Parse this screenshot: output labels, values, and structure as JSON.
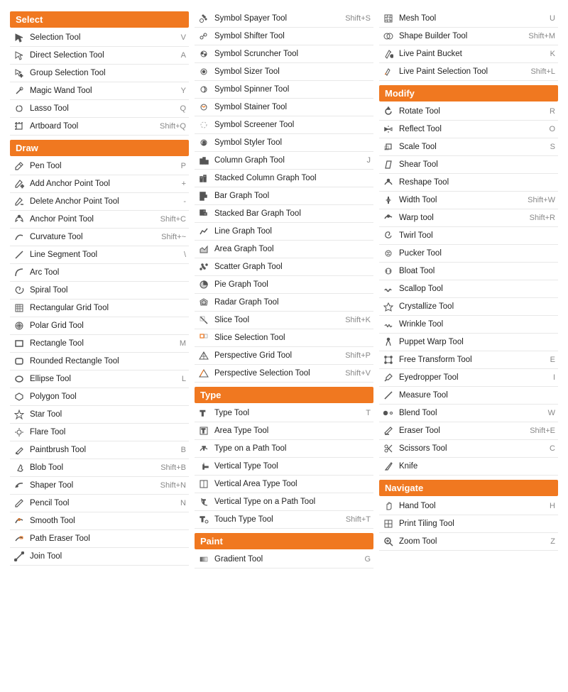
{
  "columns": [
    {
      "sections": [
        {
          "header": "Select",
          "tools": [
            {
              "name": "Selection Tool",
              "shortcut": "V",
              "icon": "arrow"
            },
            {
              "name": "Direct Selection Tool",
              "shortcut": "A",
              "icon": "arrow-hollow"
            },
            {
              "name": "Group Selection Tool",
              "shortcut": "",
              "icon": "arrow-plus"
            },
            {
              "name": "Magic Wand Tool",
              "shortcut": "Y",
              "icon": "wand"
            },
            {
              "name": "Lasso Tool",
              "shortcut": "Q",
              "icon": "lasso"
            },
            {
              "name": "Artboard Tool",
              "shortcut": "Shift+Q",
              "icon": "artboard"
            }
          ]
        },
        {
          "header": "Draw",
          "tools": [
            {
              "name": "Pen Tool",
              "shortcut": "P",
              "icon": "pen"
            },
            {
              "name": "Add Anchor Point Tool",
              "shortcut": "+",
              "icon": "pen-plus"
            },
            {
              "name": "Delete Anchor Point Tool",
              "shortcut": "-",
              "icon": "pen-minus"
            },
            {
              "name": "Anchor Point Tool",
              "shortcut": "Shift+C",
              "icon": "anchor"
            },
            {
              "name": "Curvature Tool",
              "shortcut": "Shift+~",
              "icon": "curve"
            },
            {
              "name": "Line Segment Tool",
              "shortcut": "\\",
              "icon": "line"
            },
            {
              "name": "Arc Tool",
              "shortcut": "",
              "icon": "arc"
            },
            {
              "name": "Spiral Tool",
              "shortcut": "",
              "icon": "spiral"
            },
            {
              "name": "Rectangular Grid Tool",
              "shortcut": "",
              "icon": "grid-rect"
            },
            {
              "name": "Polar Grid Tool",
              "shortcut": "",
              "icon": "grid-polar"
            },
            {
              "name": "Rectangle Tool",
              "shortcut": "M",
              "icon": "rect"
            },
            {
              "name": "Rounded Rectangle Tool",
              "shortcut": "",
              "icon": "rect-round"
            },
            {
              "name": "Ellipse Tool",
              "shortcut": "L",
              "icon": "ellipse"
            },
            {
              "name": "Polygon Tool",
              "shortcut": "",
              "icon": "polygon"
            },
            {
              "name": "Star Tool",
              "shortcut": "",
              "icon": "star"
            },
            {
              "name": "Flare Tool",
              "shortcut": "",
              "icon": "flare"
            },
            {
              "name": "Paintbrush Tool",
              "shortcut": "B",
              "icon": "brush"
            },
            {
              "name": "Blob Tool",
              "shortcut": "Shift+B",
              "icon": "blob"
            },
            {
              "name": "Shaper Tool",
              "shortcut": "Shift+N",
              "icon": "shaper"
            },
            {
              "name": "Pencil Tool",
              "shortcut": "N",
              "icon": "pencil"
            },
            {
              "name": "Smooth Tool",
              "shortcut": "",
              "icon": "smooth"
            },
            {
              "name": "Path Eraser Tool",
              "shortcut": "",
              "icon": "path-eraser"
            },
            {
              "name": "Join Tool",
              "shortcut": "",
              "icon": "join"
            }
          ]
        }
      ]
    },
    {
      "sections": [
        {
          "header": null,
          "tools": [
            {
              "name": "Symbol Spayer Tool",
              "shortcut": "Shift+S",
              "icon": "symbol-spray"
            },
            {
              "name": "Symbol Shifter Tool",
              "shortcut": "",
              "icon": "symbol-shift"
            },
            {
              "name": "Symbol Scruncher Tool",
              "shortcut": "",
              "icon": "symbol-scrunch"
            },
            {
              "name": "Symbol Sizer Tool",
              "shortcut": "",
              "icon": "symbol-size"
            },
            {
              "name": "Symbol Spinner Tool",
              "shortcut": "",
              "icon": "symbol-spin"
            },
            {
              "name": "Symbol Stainer Tool",
              "shortcut": "",
              "icon": "symbol-stain"
            },
            {
              "name": "Symbol Screener Tool",
              "shortcut": "",
              "icon": "symbol-screen"
            },
            {
              "name": "Symbol Styler Tool",
              "shortcut": "",
              "icon": "symbol-style"
            },
            {
              "name": "Column Graph Tool",
              "shortcut": "J",
              "icon": "graph-col"
            },
            {
              "name": "Stacked Column Graph Tool",
              "shortcut": "",
              "icon": "graph-stack-col"
            },
            {
              "name": "Bar Graph Tool",
              "shortcut": "",
              "icon": "graph-bar"
            },
            {
              "name": "Stacked Bar Graph Tool",
              "shortcut": "",
              "icon": "graph-stack-bar"
            },
            {
              "name": "Line Graph Tool",
              "shortcut": "",
              "icon": "graph-line"
            },
            {
              "name": "Area Graph Tool",
              "shortcut": "",
              "icon": "graph-area"
            },
            {
              "name": "Scatter Graph Tool",
              "shortcut": "",
              "icon": "graph-scatter"
            },
            {
              "name": "Pie Graph Tool",
              "shortcut": "",
              "icon": "graph-pie"
            },
            {
              "name": "Radar Graph Tool",
              "shortcut": "",
              "icon": "graph-radar"
            },
            {
              "name": "Slice Tool",
              "shortcut": "Shift+K",
              "icon": "slice"
            },
            {
              "name": "Slice Selection Tool",
              "shortcut": "",
              "icon": "slice-select"
            },
            {
              "name": "Perspective Grid Tool",
              "shortcut": "Shift+P",
              "icon": "perspective"
            },
            {
              "name": "Perspective Selection Tool",
              "shortcut": "Shift+V",
              "icon": "perspective-select"
            }
          ]
        },
        {
          "header": "Type",
          "tools": [
            {
              "name": "Type Tool",
              "shortcut": "T",
              "icon": "type"
            },
            {
              "name": "Area Type Tool",
              "shortcut": "",
              "icon": "type-area"
            },
            {
              "name": "Type on a Path Tool",
              "shortcut": "",
              "icon": "type-path"
            },
            {
              "name": "Vertical Type Tool",
              "shortcut": "",
              "icon": "type-vert"
            },
            {
              "name": "Vertical Area Type Tool",
              "shortcut": "",
              "icon": "type-vert-area"
            },
            {
              "name": "Vertical Type on a Path Tool",
              "shortcut": "",
              "icon": "type-vert-path"
            },
            {
              "name": "Touch Type Tool",
              "shortcut": "Shift+T",
              "icon": "type-touch"
            }
          ]
        },
        {
          "header": "Paint",
          "tools": [
            {
              "name": "Gradient Tool",
              "shortcut": "G",
              "icon": "gradient"
            }
          ]
        }
      ]
    },
    {
      "sections": [
        {
          "header": null,
          "tools": [
            {
              "name": "Mesh Tool",
              "shortcut": "U",
              "icon": "mesh"
            },
            {
              "name": "Shape Builder Tool",
              "shortcut": "Shift+M",
              "icon": "shape-builder"
            },
            {
              "name": "Live Paint Bucket",
              "shortcut": "K",
              "icon": "paint-bucket"
            },
            {
              "name": "Live Paint Selection Tool",
              "shortcut": "Shift+L",
              "icon": "paint-select"
            }
          ]
        },
        {
          "header": "Modify",
          "tools": [
            {
              "name": "Rotate Tool",
              "shortcut": "R",
              "icon": "rotate"
            },
            {
              "name": "Reflect Tool",
              "shortcut": "O",
              "icon": "reflect"
            },
            {
              "name": "Scale Tool",
              "shortcut": "S",
              "icon": "scale"
            },
            {
              "name": "Shear Tool",
              "shortcut": "",
              "icon": "shear"
            },
            {
              "name": "Reshape Tool",
              "shortcut": "",
              "icon": "reshape"
            },
            {
              "name": "Width Tool",
              "shortcut": "Shift+W",
              "icon": "width"
            },
            {
              "name": "Warp tool",
              "shortcut": "Shift+R",
              "icon": "warp"
            },
            {
              "name": "Twirl Tool",
              "shortcut": "",
              "icon": "twirl"
            },
            {
              "name": "Pucker Tool",
              "shortcut": "",
              "icon": "pucker"
            },
            {
              "name": "Bloat Tool",
              "shortcut": "",
              "icon": "bloat"
            },
            {
              "name": "Scallop Tool",
              "shortcut": "",
              "icon": "scallop"
            },
            {
              "name": "Crystallize Tool",
              "shortcut": "",
              "icon": "crystallize"
            },
            {
              "name": "Wrinkle Tool",
              "shortcut": "",
              "icon": "wrinkle"
            },
            {
              "name": "Puppet Warp Tool",
              "shortcut": "",
              "icon": "puppet-warp"
            },
            {
              "name": "Free Transform Tool",
              "shortcut": "E",
              "icon": "free-transform"
            },
            {
              "name": "Eyedropper Tool",
              "shortcut": "I",
              "icon": "eyedropper"
            },
            {
              "name": "Measure Tool",
              "shortcut": "",
              "icon": "measure"
            },
            {
              "name": "Blend Tool",
              "shortcut": "W",
              "icon": "blend"
            },
            {
              "name": "Eraser Tool",
              "shortcut": "Shift+E",
              "icon": "eraser"
            },
            {
              "name": "Scissors Tool",
              "shortcut": "C",
              "icon": "scissors"
            },
            {
              "name": "Knife",
              "shortcut": "",
              "icon": "knife"
            }
          ]
        },
        {
          "header": "Navigate",
          "tools": [
            {
              "name": "Hand Tool",
              "shortcut": "H",
              "icon": "hand"
            },
            {
              "name": "Print Tiling Tool",
              "shortcut": "",
              "icon": "print-tiling"
            },
            {
              "name": "Zoom Tool",
              "shortcut": "Z",
              "icon": "zoom"
            }
          ]
        }
      ]
    }
  ]
}
